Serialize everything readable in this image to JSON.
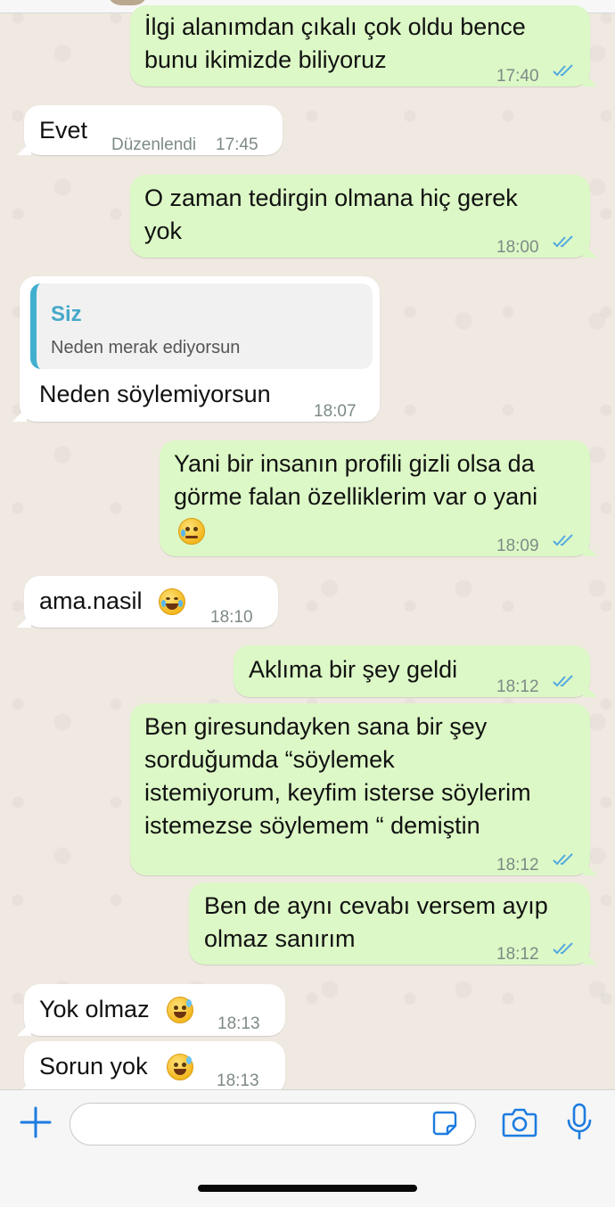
{
  "messages": [
    {
      "id": "m1",
      "dir": "out",
      "lines": "İlgi alanımdan çıkalı çok oldu bence\nbunu ikimizde biliyoruz",
      "time": "17:40",
      "read": true
    },
    {
      "id": "m2",
      "dir": "in",
      "lines": "Evet",
      "edited_label": "Düzenlendi",
      "time": "17:45"
    },
    {
      "id": "m3",
      "dir": "out",
      "lines": "O zaman tedirgin olmana hiç gerek\nyok",
      "time": "18:00",
      "read": true
    },
    {
      "id": "m4",
      "dir": "in",
      "quote": {
        "author": "Siz",
        "text": "Neden merak ediyorsun"
      },
      "lines": "Neden söylemiyorsun",
      "time": "18:07"
    },
    {
      "id": "m5",
      "dir": "out",
      "lines": "Yani bir insanın profili gizli olsa da\ngörme falan özelliklerim var o yani",
      "emoji": "sad-tear-face",
      "time": "18:09",
      "read": true
    },
    {
      "id": "m6",
      "dir": "in",
      "lines": "ama.nasil",
      "emoji": "tears-of-joy-face",
      "time": "18:10"
    },
    {
      "id": "m7",
      "dir": "out",
      "lines": "Aklıma bir şey geldi",
      "time": "18:12",
      "read": true
    },
    {
      "id": "m8",
      "dir": "out",
      "lines": "Ben giresundayken sana bir şey\nsorduğumda “söylemek\nistemiyorum, keyfim isterse söylerim\nistemezse söylemem “ demiştin",
      "time": "18:12",
      "read": true
    },
    {
      "id": "m9",
      "dir": "out",
      "lines": "Ben de aynı cevabı versem ayıp\nolmaz sanırım",
      "time": "18:12",
      "read": true
    },
    {
      "id": "m10",
      "dir": "in",
      "lines": "Yok olmaz",
      "emoji": "grinning-sweat-face",
      "time": "18:13"
    },
    {
      "id": "m11",
      "dir": "in",
      "lines": "Sorun yok",
      "emoji": "grinning-sweat-face",
      "time": "18:13"
    }
  ],
  "composer": {
    "placeholder": "",
    "icons": [
      "plus-icon",
      "sticker-icon",
      "camera-icon",
      "microphone-icon"
    ]
  },
  "colors": {
    "outgoing_bubble": "#dcf8c6",
    "incoming_bubble": "#ffffff",
    "read_ticks": "#53a9e0",
    "accent": "#1c7ce0",
    "quote_bar": "#41b0cf"
  }
}
